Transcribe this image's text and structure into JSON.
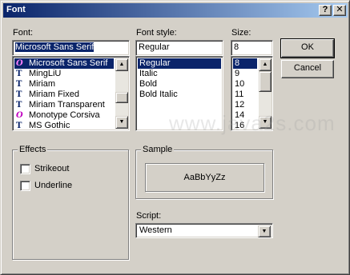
{
  "window": {
    "title": "Font",
    "help_label": "?",
    "close_label": "✕"
  },
  "font": {
    "label": "Font:",
    "value": "Microsoft Sans Serif",
    "items": [
      {
        "icon": "open-type",
        "glyph": "O",
        "label": "Microsoft Sans Serif",
        "selected": true
      },
      {
        "icon": "true-type",
        "glyph": "T",
        "label": "MingLiU",
        "selected": false
      },
      {
        "icon": "true-type",
        "glyph": "T",
        "label": "Miriam",
        "selected": false
      },
      {
        "icon": "true-type",
        "glyph": "T",
        "label": "Miriam Fixed",
        "selected": false
      },
      {
        "icon": "true-type",
        "glyph": "T",
        "label": "Miriam Transparent",
        "selected": false
      },
      {
        "icon": "open-type",
        "glyph": "O",
        "label": "Monotype Corsiva",
        "selected": false
      },
      {
        "icon": "true-type",
        "glyph": "T",
        "label": "MS Gothic",
        "selected": false
      }
    ]
  },
  "style": {
    "label": "Font style:",
    "value": "Regular",
    "items": [
      {
        "label": "Regular",
        "selected": true
      },
      {
        "label": "Italic",
        "selected": false
      },
      {
        "label": "Bold",
        "selected": false
      },
      {
        "label": "Bold Italic",
        "selected": false
      }
    ]
  },
  "size": {
    "label": "Size:",
    "value": "8",
    "items": [
      {
        "label": "8",
        "selected": true
      },
      {
        "label": "9",
        "selected": false
      },
      {
        "label": "10",
        "selected": false
      },
      {
        "label": "11",
        "selected": false
      },
      {
        "label": "12",
        "selected": false
      },
      {
        "label": "14",
        "selected": false
      },
      {
        "label": "16",
        "selected": false
      }
    ]
  },
  "buttons": {
    "ok": "OK",
    "cancel": "Cancel"
  },
  "effects": {
    "title": "Effects",
    "strikeout": "Strikeout",
    "underline": "Underline",
    "strikeout_checked": false,
    "underline_checked": false
  },
  "sample": {
    "title": "Sample",
    "text": "AaBbYyZz"
  },
  "script": {
    "label": "Script:",
    "value": "Western"
  },
  "watermark": "www.java2s.com"
}
